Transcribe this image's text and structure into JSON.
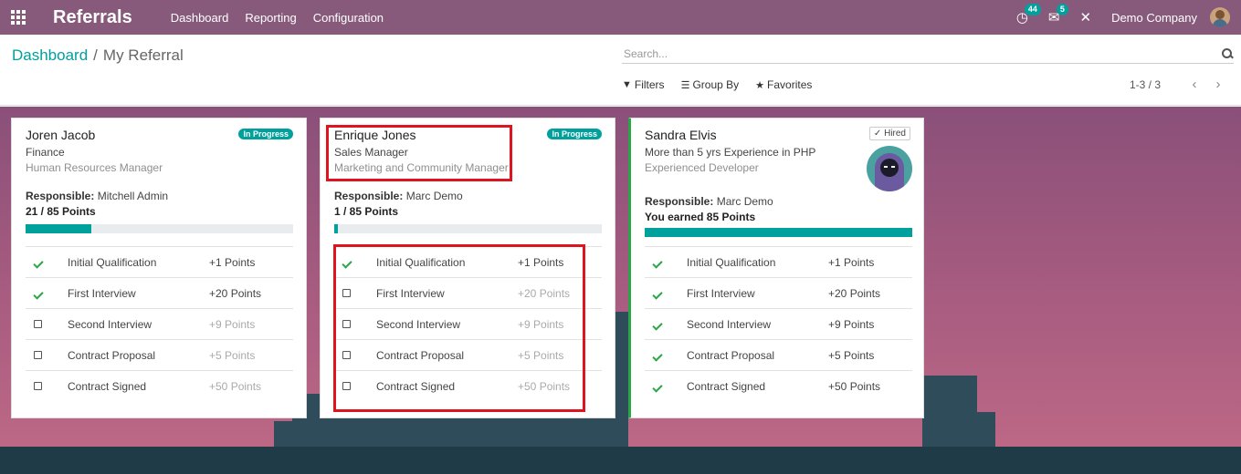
{
  "navbar": {
    "app_title": "Referrals",
    "menu": [
      "Dashboard",
      "Reporting",
      "Configuration"
    ],
    "activity_count": "44",
    "message_count": "5",
    "company": "Demo Company"
  },
  "breadcrumb": {
    "parent": "Dashboard",
    "separator": "/",
    "current": "My Referral"
  },
  "search": {
    "placeholder": "Search..."
  },
  "filters": {
    "filters_label": "Filters",
    "group_by_label": "Group By",
    "favorites_label": "Favorites"
  },
  "pager": {
    "value": "1-3 / 3"
  },
  "colors": {
    "navbar": "#875a7b",
    "accent": "#00a09d",
    "check": "#28a745",
    "highlight": "#e0141e"
  },
  "cards": [
    {
      "name": "Joren Jacob",
      "job": "Finance",
      "department": "Human Resources Manager",
      "tag": "In Progress",
      "responsible_label": "Responsible:",
      "responsible": "Mitchell Admin",
      "points_text": "21 / 85 Points",
      "progress": 0.247,
      "stages": [
        {
          "label": "Initial Qualification",
          "points": "+1 Points",
          "done": true
        },
        {
          "label": "First Interview",
          "points": "+20 Points",
          "done": true
        },
        {
          "label": "Second Interview",
          "points": "+9 Points",
          "done": false
        },
        {
          "label": "Contract Proposal",
          "points": "+5 Points",
          "done": false
        },
        {
          "label": "Contract Signed",
          "points": "+50 Points",
          "done": false
        }
      ]
    },
    {
      "name": "Enrique Jones",
      "job": "Sales Manager",
      "department": "Marketing and Community Manager",
      "tag": "In Progress",
      "responsible_label": "Responsible:",
      "responsible": "Marc Demo",
      "points_text": "1 / 85 Points",
      "progress": 0.012,
      "stages": [
        {
          "label": "Initial Qualification",
          "points": "+1 Points",
          "done": true
        },
        {
          "label": "First Interview",
          "points": "+20 Points",
          "done": false
        },
        {
          "label": "Second Interview",
          "points": "+9 Points",
          "done": false
        },
        {
          "label": "Contract Proposal",
          "points": "+5 Points",
          "done": false
        },
        {
          "label": "Contract Signed",
          "points": "+50 Points",
          "done": false
        }
      ]
    },
    {
      "name": "Sandra Elvis",
      "job": "More than 5 yrs Experience in PHP",
      "department": "Experienced Developer",
      "tag": "Hired",
      "responsible_label": "Responsible:",
      "responsible": "Marc Demo",
      "points_text": "You earned 85 Points",
      "progress": 1.0,
      "stages": [
        {
          "label": "Initial Qualification",
          "points": "+1 Points",
          "done": true
        },
        {
          "label": "First Interview",
          "points": "+20 Points",
          "done": true
        },
        {
          "label": "Second Interview",
          "points": "+9 Points",
          "done": true
        },
        {
          "label": "Contract Proposal",
          "points": "+5 Points",
          "done": true
        },
        {
          "label": "Contract Signed",
          "points": "+50 Points",
          "done": true
        }
      ]
    }
  ]
}
